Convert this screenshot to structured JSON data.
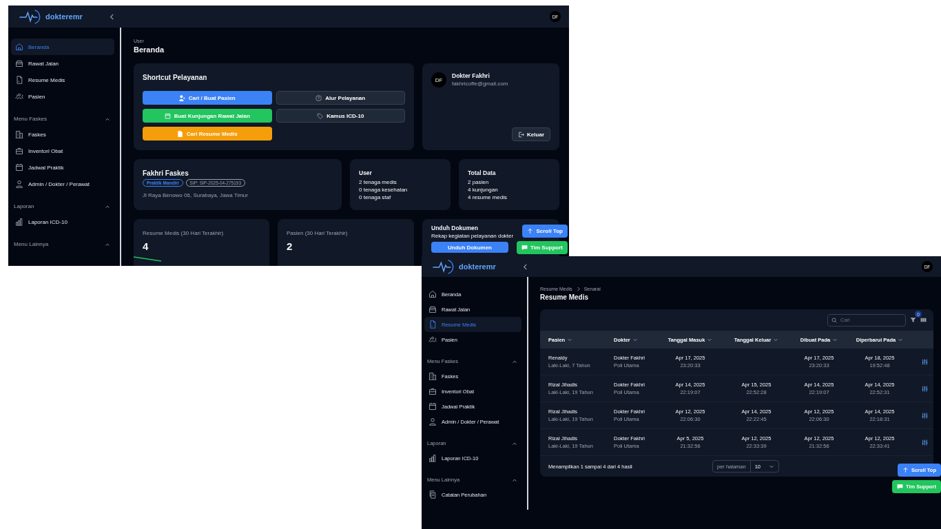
{
  "windows": [
    {
      "kind": "dashboard",
      "header": {
        "logo": "dokteremr",
        "avatar": "DF"
      },
      "sidebar": [
        {
          "items": [
            {
              "label": "Beranda",
              "kind": "home",
              "selected": true
            },
            {
              "label": "Rawat Jalan",
              "kind": "tray",
              "selected": false
            },
            {
              "label": "Resume Medis",
              "kind": "file",
              "selected": false
            },
            {
              "label": "Pasien",
              "kind": "users",
              "selected": false
            }
          ]
        },
        {
          "title": "Menu Faskes",
          "expanded": true,
          "items": [
            {
              "label": "Faskes",
              "kind": "building",
              "selected": false
            },
            {
              "label": "Inventori Obat",
              "kind": "briefcase",
              "selected": false
            },
            {
              "label": "Jadwal Praktik",
              "kind": "calendar",
              "selected": false
            },
            {
              "label": "Admin / Dokter / Perawat",
              "kind": "user",
              "selected": false
            }
          ]
        },
        {
          "title": "Laporan",
          "expanded": true,
          "items": [
            {
              "label": "Laporan ICD-10",
              "kind": "chart",
              "selected": false
            }
          ]
        },
        {
          "title": "Menu Lainnya",
          "expanded": true
        }
      ],
      "breadcrumb": [
        "User"
      ],
      "title": "Beranda",
      "shortcut": {
        "title": "Shortcut Pelayanan",
        "buttons": [
          {
            "label": "Cari / Buat Pasien",
            "kind": "primary"
          },
          {
            "label": "Alur Pelayanan",
            "kind": "secondary"
          },
          {
            "label": "Buat Kunjungan Rawat Jalan",
            "kind": "success"
          },
          {
            "label": "Kamus ICD-10",
            "kind": "secondary"
          },
          {
            "label": "Cari Resume Medis",
            "kind": "warning"
          }
        ]
      },
      "profile": {
        "avatar": "DF",
        "name": "Dokter Fakhri",
        "email": "fakhricoffe@gmail.com",
        "logout": "Keluar"
      },
      "facility": {
        "name": "Fakhri Faskes",
        "badges": [
          {
            "label": "Praktik Mandiri",
            "color": "#3b82f6"
          },
          {
            "label": "SIP: SIP-2025-04-275193",
            "color": "#9ca3af"
          }
        ],
        "address": "Jl Raya Benowo 06, Surabaya, Jawa Timur"
      },
      "info_cards": [
        {
          "title": "User",
          "lines": [
            "2 tenaga medis",
            "0 tenaga kesehatan",
            "0 tenaga staf"
          ]
        },
        {
          "title": "Total Data",
          "lines": [
            "2 pasien",
            "4 kunjungan",
            "4 resume medis"
          ]
        }
      ],
      "stats": [
        {
          "label": "Resume Medis (30 Hari Terakhir)",
          "value": "4"
        },
        {
          "label": "Pasien (30 Hari Terakhir)",
          "value": "2"
        }
      ],
      "download": {
        "title": "Unduh Dokumen",
        "text": "Rekap kegiatan pelayanan dokter",
        "button": "Unduh Dokumen"
      },
      "floating": {
        "scroll_top": "Scroll Top",
        "support": "Tim Support"
      }
    },
    {
      "kind": "list",
      "header": {
        "logo": "dokteremr",
        "avatar": "DF"
      },
      "sidebar": [
        {
          "items": [
            {
              "label": "Beranda",
              "kind": "home",
              "selected": false
            },
            {
              "label": "Rawat Jalan",
              "kind": "tray",
              "selected": false
            },
            {
              "label": "Resume Medis",
              "kind": "file",
              "selected": true
            },
            {
              "label": "Pasien",
              "kind": "users",
              "selected": false
            }
          ]
        },
        {
          "title": "Menu Faskes",
          "expanded": true,
          "items": [
            {
              "label": "Faskes",
              "kind": "building",
              "selected": false
            },
            {
              "label": "Inventori Obat",
              "kind": "briefcase",
              "selected": false
            },
            {
              "label": "Jadwal Praktik",
              "kind": "calendar",
              "selected": false
            },
            {
              "label": "Admin / Dokter / Perawat",
              "kind": "user",
              "selected": false
            }
          ]
        },
        {
          "title": "Laporan",
          "expanded": true,
          "items": [
            {
              "label": "Laporan ICD-10",
              "kind": "chart",
              "selected": false
            }
          ]
        },
        {
          "title": "Menu Lainnya",
          "expanded": true,
          "items": [
            {
              "label": "Catatan Perubahan",
              "kind": "copy",
              "selected": false
            }
          ]
        }
      ],
      "breadcrumb": [
        "Resume Medis",
        "Senarai"
      ],
      "title": "Resume Medis",
      "search": {
        "placeholder": "Cari"
      },
      "filter_count": "0",
      "table": {
        "columns": [
          "Pasien",
          "Dokter",
          "Tanggal Masuk",
          "Tanggal Keluar",
          "Dibuat Pada",
          "Diperbarui Pada"
        ],
        "rows": [
          {
            "patient": "Renaldy",
            "patient_info": "Laki-Laki, 7 Tahun",
            "doctor": "Dokter Fakhri",
            "clinic": "Poli Utama",
            "admitted": [
              "Apr 17, 2025",
              "23:20:33"
            ],
            "created": [
              "Apr 17, 2025",
              "23:20:33"
            ],
            "updated": [
              "Apr 18, 2025",
              "19:52:48"
            ]
          },
          {
            "patient": "Rizal Jihadis",
            "patient_info": "Laki-Laki, 19 Tahun",
            "doctor": "Dokter Fakhri",
            "clinic": "Poli Utama",
            "admitted": [
              "Apr 14, 2025",
              "22:19:07"
            ],
            "discharged": [
              "Apr 15, 2025",
              "22:52:28"
            ],
            "created": [
              "Apr 14, 2025",
              "22:19:07"
            ],
            "updated": [
              "Apr 14, 2025",
              "22:52:31"
            ]
          },
          {
            "patient": "Rizal Jihadis",
            "patient_info": "Laki-Laki, 19 Tahun",
            "doctor": "Dokter Fakhri",
            "clinic": "Poli Utama",
            "admitted": [
              "Apr 12, 2025",
              "22:06:30"
            ],
            "discharged": [
              "Apr 14, 2025",
              "22:22:45"
            ],
            "created": [
              "Apr 12, 2025",
              "22:06:30"
            ],
            "updated": [
              "Apr 14, 2025",
              "22:18:31"
            ]
          },
          {
            "patient": "Rizal Jihadis",
            "patient_info": "Laki-Laki, 19 Tahun",
            "doctor": "Dokter Fakhri",
            "clinic": "Poli Utama",
            "admitted": [
              "Apr 5, 2025",
              "21:32:56"
            ],
            "discharged": [
              "Apr 12, 2025",
              "22:33:39"
            ],
            "created": [
              "Apr 12, 2025",
              "21:32:56"
            ],
            "updated": [
              "Apr 12, 2025",
              "22:33:41"
            ]
          }
        ]
      },
      "footer": {
        "summary": "Menampilkan 1 sampai 4 dari 4 hasil",
        "per_page_label": "per halaman",
        "per_page": "10"
      },
      "floating": {
        "scroll_top": "Scroll Top",
        "support": "Tim Support"
      }
    }
  ]
}
